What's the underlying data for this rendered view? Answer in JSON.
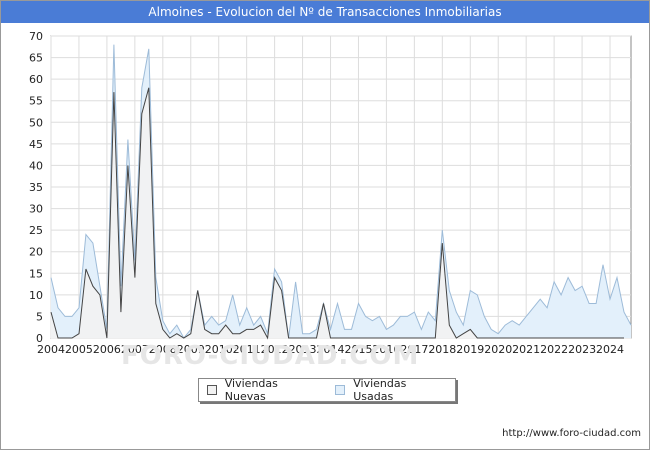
{
  "title": "Almoines - Evolucion del Nº de Transacciones Inmobiliarias",
  "footer": "http://www.foro-ciudad.com",
  "watermark": "FORO-CIUDAD.COM",
  "chart_data": {
    "type": "area",
    "title": "Almoines - Evolucion del Nº de Transacciones Inmobiliarias",
    "xlabel": "",
    "ylabel": "",
    "ylim": [
      0,
      70
    ],
    "yticks": [
      0,
      5,
      10,
      15,
      20,
      25,
      30,
      35,
      40,
      45,
      50,
      55,
      60,
      65,
      70
    ],
    "xlim": [
      2004,
      2024.75
    ],
    "xticks": [
      2004,
      2005,
      2006,
      2007,
      2008,
      2009,
      2010,
      2011,
      2012,
      2013,
      2014,
      2015,
      2016,
      2017,
      2018,
      2019,
      2020,
      2021,
      2022,
      2023,
      2024
    ],
    "grid": true,
    "legend_position": "bottom",
    "x_step": "quarter",
    "series": [
      {
        "name": "Viviendas Nuevas",
        "color": "#f2f2f2",
        "stroke": "#444444",
        "values": [
          6,
          0,
          0,
          0,
          1,
          16,
          12,
          10,
          0,
          57,
          6,
          40,
          14,
          52,
          58,
          8,
          2,
          0,
          1,
          0,
          1,
          11,
          2,
          1,
          1,
          3,
          1,
          1,
          2,
          2,
          3,
          0,
          14,
          11,
          0,
          0,
          0,
          0,
          0,
          8,
          0,
          0,
          0,
          0,
          0,
          0,
          0,
          0,
          0,
          0,
          0,
          0,
          0,
          0,
          0,
          0,
          22,
          3,
          0,
          1,
          2,
          0,
          0,
          0,
          0,
          0,
          0,
          0,
          0,
          0,
          0,
          0,
          0,
          0,
          0,
          0,
          0,
          0,
          0,
          0,
          0,
          0,
          0
        ]
      },
      {
        "name": "Viviendas Usadas",
        "color": "#e3f0fb",
        "stroke": "#9dbbd8",
        "values": [
          14,
          7,
          5,
          5,
          7,
          24,
          22,
          12,
          2,
          68,
          12,
          46,
          18,
          58,
          67,
          14,
          4,
          1,
          3,
          0,
          2,
          11,
          3,
          5,
          3,
          4,
          10,
          3,
          7,
          3,
          5,
          1,
          16,
          13,
          0,
          13,
          1,
          1,
          2,
          8,
          2,
          8,
          2,
          2,
          8,
          5,
          4,
          5,
          2,
          3,
          5,
          5,
          6,
          2,
          6,
          4,
          25,
          11,
          6,
          3,
          11,
          10,
          5,
          2,
          1,
          3,
          4,
          3,
          5,
          7,
          9,
          7,
          13,
          10,
          14,
          11,
          12,
          8,
          8,
          17,
          9,
          14,
          6,
          3
        ]
      }
    ]
  }
}
